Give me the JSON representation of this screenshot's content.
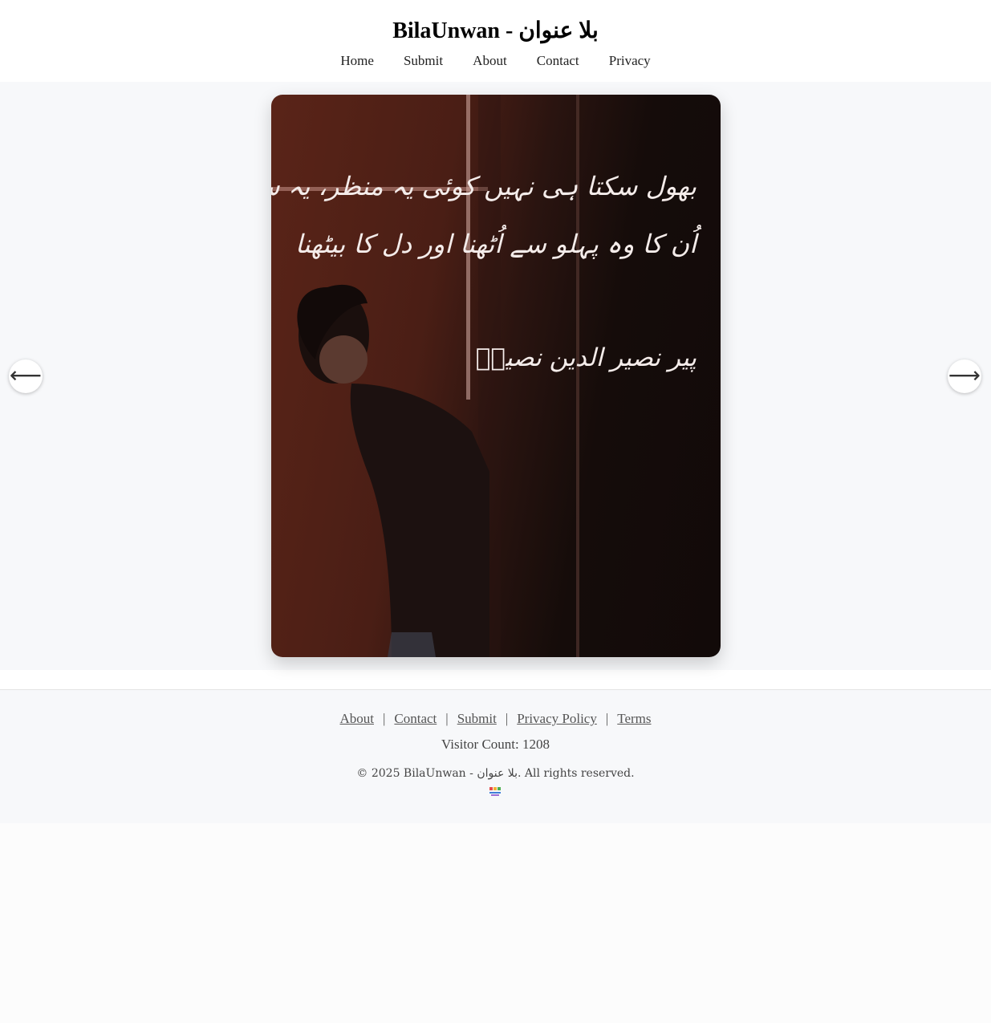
{
  "header": {
    "title": "BilaUnwan - بلا عنوان",
    "nav": [
      "Home",
      "Submit",
      "About",
      "Contact",
      "Privacy"
    ]
  },
  "carousel": {
    "poem_lines": [
      "بھول سکتا ہی نہیں کوئی یہ منظر، یہ سماں",
      "اُن کا وہ پہلو سے اُٹھنا اور دل کا بیٹھنا"
    ],
    "poet": "پیر نصیر الدین نصیرؔ",
    "prev_icon": "arrow-left-icon",
    "next_icon": "arrow-right-icon",
    "prev_symbol": "⟵",
    "next_symbol": "⟶"
  },
  "footer": {
    "links": [
      "About",
      "Contact",
      "Submit",
      "Privacy Policy",
      "Terms"
    ],
    "separator": "|",
    "visitor_count": "Visitor Count: 1208",
    "copyright": "© 2025 BilaUnwan - بلا عنوان. All rights reserved."
  }
}
